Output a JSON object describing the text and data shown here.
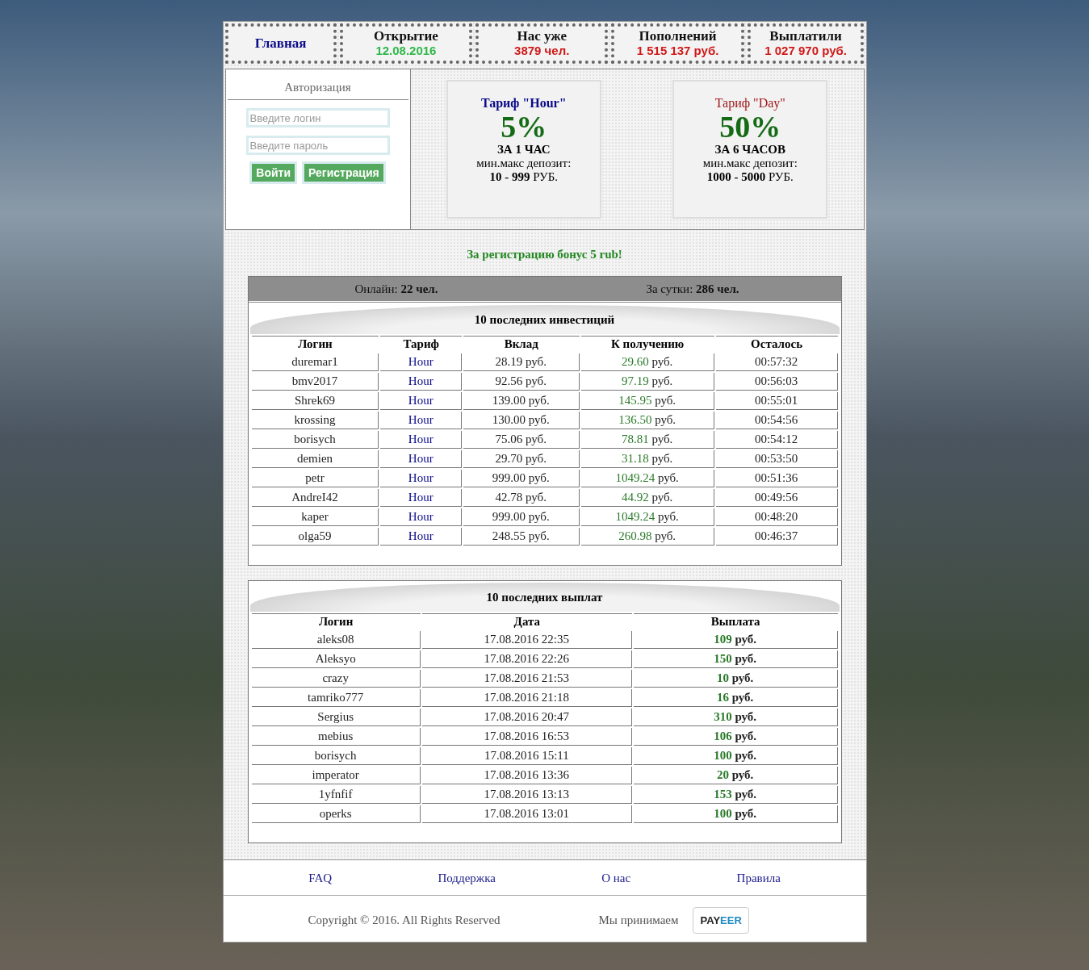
{
  "header": [
    {
      "kind": "link",
      "label": "Главная"
    },
    {
      "kind": "stat",
      "label": "Открытие",
      "value": "12.08.2016",
      "color": "#2fb84a"
    },
    {
      "kind": "stat",
      "label": "Нас уже",
      "value": "3879 чел.",
      "color": "#d01818"
    },
    {
      "kind": "stat",
      "label": "Пополнений",
      "value": "1 515 137 руб.",
      "color": "#d01818"
    },
    {
      "kind": "stat",
      "label": "Выплатили",
      "value": "1 027 970 руб.",
      "color": "#d01818"
    }
  ],
  "auth": {
    "title": "Авторизация",
    "login": {
      "placeholder": "Введите логин"
    },
    "password": {
      "placeholder": "Введите пароль"
    },
    "buttons": [
      "Войти",
      "Регистрация"
    ]
  },
  "tariffs": [
    {
      "title": "Тариф \"Hour\"",
      "title_bold": true,
      "color": "#0a0a8a",
      "percent": "5%",
      "period": "ЗА 1 ЧАС",
      "deposit_label": "мин.макс депозит:",
      "deposit_range": "10 - 999",
      "currency": "РУБ."
    },
    {
      "title": "Тариф \"Day\"",
      "title_bold": false,
      "color": "#a01818",
      "percent": "50%",
      "period": "ЗА 6 ЧАСОВ",
      "deposit_label": "мин.макс депозит:",
      "deposit_range": "1000 - 5000",
      "currency": "РУБ."
    }
  ],
  "bonus": "За регистрацию бонус 5 rub!",
  "stats": [
    "Онлайн: **22 чел.**",
    "За сутки: **286 чел.**"
  ],
  "investments": {
    "title": "10 последних инвестиций",
    "columns": [
      "Логин",
      "Тариф",
      "Вклад",
      "К получению",
      "Осталось"
    ],
    "rows": [
      {
        "login": "duremar1",
        "tariff": "Hour",
        "deposit": "28.19 руб.",
        "amount": "29.60",
        "unit": "руб.",
        "left": "00:57:32"
      },
      {
        "login": "bmv2017",
        "tariff": "Hour",
        "deposit": "92.56 руб.",
        "amount": "97.19",
        "unit": "руб.",
        "left": "00:56:03"
      },
      {
        "login": "Shrek69",
        "tariff": "Hour",
        "deposit": "139.00 руб.",
        "amount": "145.95",
        "unit": "руб.",
        "left": "00:55:01"
      },
      {
        "login": "krossing",
        "tariff": "Hour",
        "deposit": "130.00 руб.",
        "amount": "136.50",
        "unit": "руб.",
        "left": "00:54:56"
      },
      {
        "login": "borisych",
        "tariff": "Hour",
        "deposit": "75.06 руб.",
        "amount": "78.81",
        "unit": "руб.",
        "left": "00:54:12"
      },
      {
        "login": "demien",
        "tariff": "Hour",
        "deposit": "29.70 руб.",
        "amount": "31.18",
        "unit": "руб.",
        "left": "00:53:50"
      },
      {
        "login": "petr",
        "tariff": "Hour",
        "deposit": "999.00 руб.",
        "amount": "1049.24",
        "unit": "руб.",
        "left": "00:51:36"
      },
      {
        "login": "AndreI42",
        "tariff": "Hour",
        "deposit": "42.78 руб.",
        "amount": "44.92",
        "unit": "руб.",
        "left": "00:49:56"
      },
      {
        "login": "kaper",
        "tariff": "Hour",
        "deposit": "999.00 руб.",
        "amount": "1049.24",
        "unit": "руб.",
        "left": "00:48:20"
      },
      {
        "login": "olga59",
        "tariff": "Hour",
        "deposit": "248.55 руб.",
        "amount": "260.98",
        "unit": "руб.",
        "left": "00:46:37"
      }
    ]
  },
  "payouts": {
    "title": "10 последних выплат",
    "columns": [
      "Логин",
      "Дата",
      "Выплата"
    ],
    "rows": [
      {
        "login": "aleks08",
        "date": "17.08.2016 22:35",
        "amount": "109",
        "unit": "руб."
      },
      {
        "login": "Aleksyo",
        "date": "17.08.2016 22:26",
        "amount": "150",
        "unit": "руб."
      },
      {
        "login": "crazy",
        "date": "17.08.2016 21:53",
        "amount": "10",
        "unit": "руб."
      },
      {
        "login": "tamriko777",
        "date": "17.08.2016 21:18",
        "amount": "16",
        "unit": "руб."
      },
      {
        "login": "Sergius",
        "date": "17.08.2016 20:47",
        "amount": "310",
        "unit": "руб."
      },
      {
        "login": "mebius",
        "date": "17.08.2016 16:53",
        "amount": "106",
        "unit": "руб."
      },
      {
        "login": "borisych",
        "date": "17.08.2016 15:11",
        "amount": "100",
        "unit": "руб."
      },
      {
        "login": "imperator",
        "date": "17.08.2016 13:36",
        "amount": "20",
        "unit": "руб."
      },
      {
        "login": "1yfnfif",
        "date": "17.08.2016 13:13",
        "amount": "153",
        "unit": "руб."
      },
      {
        "login": "operks",
        "date": "17.08.2016 13:01",
        "amount": "100",
        "unit": "руб."
      }
    ]
  },
  "footer": {
    "links": [
      "FAQ",
      "Поддержка",
      "О нас",
      "Правила"
    ],
    "copyright": "Copyright © 2016. All Rights Reserved",
    "accept": "Мы принимаем",
    "payment_logo": [
      "PAY",
      "EER"
    ]
  }
}
